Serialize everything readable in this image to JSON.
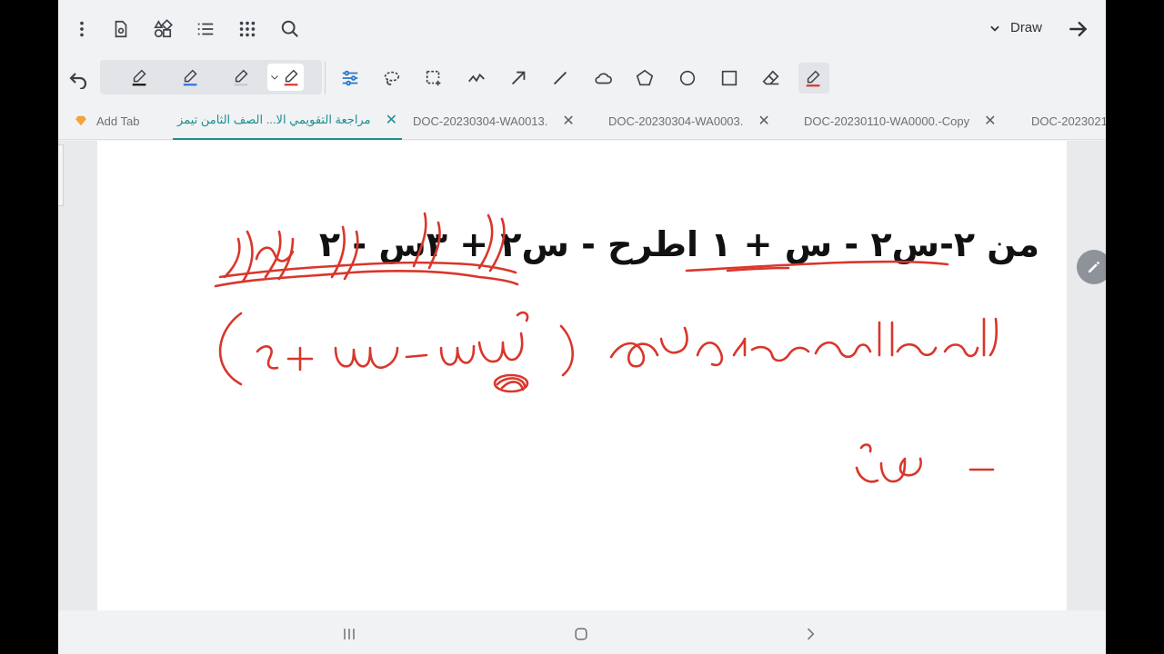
{
  "status_bar": {
    "left": "",
    "right": ""
  },
  "toolbar": {
    "icons": [
      "more-vert-icon",
      "doc-settings-icon",
      "shapes-icon",
      "list-icon",
      "apps-grid-icon",
      "search-icon"
    ],
    "mode_label": "Draw"
  },
  "draw_tools": {
    "pens": [
      {
        "name": "pen-black",
        "color": "#111111"
      },
      {
        "name": "pen-blue",
        "color": "#3a6fd8"
      },
      {
        "name": "pen-gray",
        "color": "#8a8f96"
      },
      {
        "name": "pen-red",
        "color": "#d9362b"
      }
    ],
    "tools": [
      "adjust-icon",
      "lasso-icon",
      "select-area-icon",
      "freeform-line-icon",
      "arrow-icon",
      "line-icon",
      "cloud-icon",
      "pentagon-icon",
      "circle-icon",
      "square-icon",
      "eraser-icon",
      "highlighter-icon"
    ]
  },
  "tabs": {
    "add_tab": "Add Tab",
    "items": [
      {
        "label": "مراجعة التقويمي الا... الصف الثامن تيمز",
        "active": true
      },
      {
        "label": "DOC-20230304-WA0013.",
        "active": false
      },
      {
        "label": "DOC-20230304-WA0003.",
        "active": false
      },
      {
        "label": "DOC-20230110-WA0000.-Copy",
        "active": false
      },
      {
        "label": "DOC-2023021",
        "active": false
      }
    ]
  },
  "document": {
    "equation": "من  ‎-‎٢س٢ ‎-‎ س + ١  اطرح  ‎-‎ س٢ + ٣س ‎-‎ ٢"
  },
  "colors": {
    "accent": "#1d8f8f",
    "ink": "#d9362b"
  }
}
